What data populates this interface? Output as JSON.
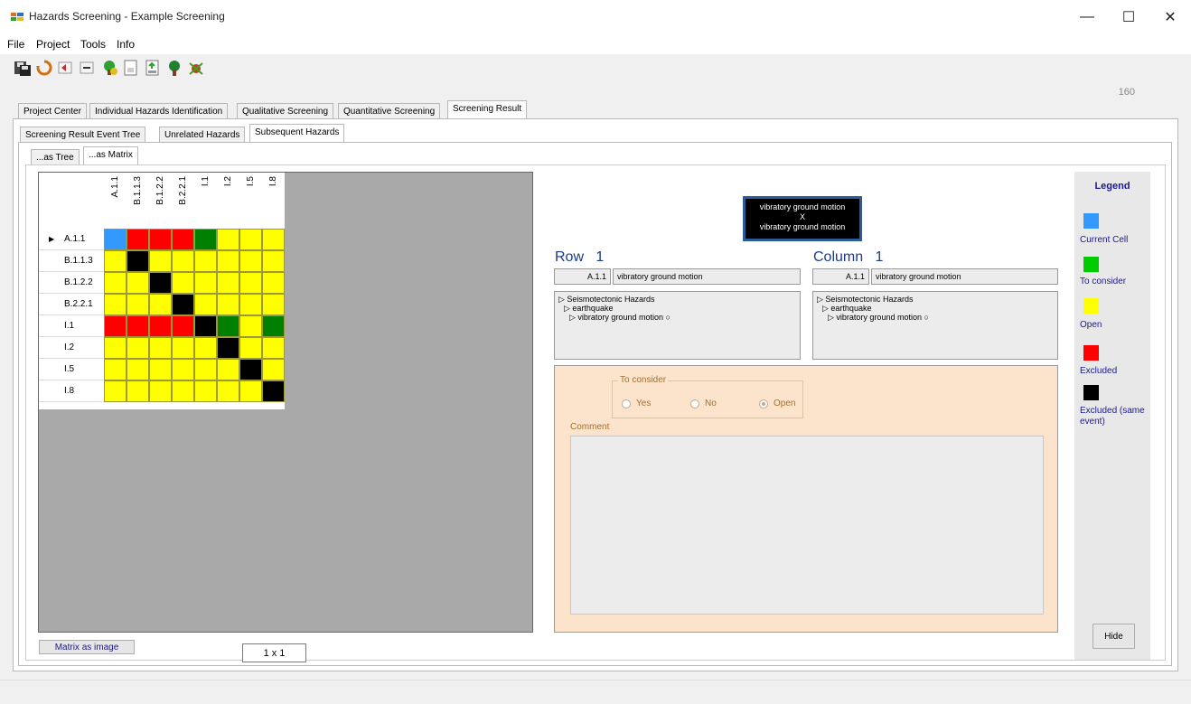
{
  "window": {
    "title": "Hazards Screening - Example Screening"
  },
  "menu": [
    "File",
    "Project",
    "Tools",
    "Info"
  ],
  "counter": "160",
  "main_tabs": [
    "Project Center",
    "Individual Hazards Identification",
    "Qualitative Screening",
    "Quantitative Screening",
    "Screening Result"
  ],
  "sub_tabs": [
    "Screening Result Event Tree",
    "Unrelated Hazards",
    "Subsequent Hazards"
  ],
  "view_tabs": [
    "...as Tree",
    "...as Matrix"
  ],
  "matrix": {
    "columns": [
      "A.1.1",
      "B.1.1.3",
      "B.1.2.2",
      "B.2.2.1",
      "I.1",
      "I.2",
      "I.5",
      "I.8"
    ],
    "rows": [
      "A.1.1",
      "B.1.1.3",
      "B.1.2.2",
      "B.2.2.1",
      "I.1",
      "I.2",
      "I.5",
      "I.8"
    ],
    "current_row_marker": "▶",
    "cells": [
      [
        "current",
        "excluded",
        "excluded",
        "excluded",
        "consider",
        "open",
        "open",
        "open"
      ],
      [
        "open",
        "same",
        "open",
        "open",
        "open",
        "open",
        "open",
        "open"
      ],
      [
        "open",
        "open",
        "same",
        "open",
        "open",
        "open",
        "open",
        "open"
      ],
      [
        "open",
        "open",
        "open",
        "same",
        "open",
        "open",
        "open",
        "open"
      ],
      [
        "excluded",
        "excluded",
        "excluded",
        "excluded",
        "same",
        "consider",
        "open",
        "consider"
      ],
      [
        "open",
        "open",
        "open",
        "open",
        "open",
        "same",
        "open",
        "open"
      ],
      [
        "open",
        "open",
        "open",
        "open",
        "open",
        "open",
        "same",
        "open"
      ],
      [
        "open",
        "open",
        "open",
        "open",
        "open",
        "open",
        "open",
        "same"
      ]
    ]
  },
  "buttons": {
    "matrix_as_image": "Matrix as image",
    "zoom": "1 x 1",
    "hide": "Hide"
  },
  "selection": {
    "line1": "vibratory ground motion",
    "line2": "X",
    "line3": "vibratory ground motion"
  },
  "row_info": {
    "label": "Row",
    "index": "1",
    "code": "A.1.1",
    "name": "vibratory ground motion",
    "tree": [
      "▷ Seismotectonic Hazards",
      "▷ earthquake",
      "▷ vibratory ground motion ○"
    ]
  },
  "col_info": {
    "label": "Column",
    "index": "1",
    "code": "A.1.1",
    "name": "vibratory ground motion",
    "tree": [
      "▷ Seismotectonic Hazards",
      "▷ earthquake",
      "▷ vibratory ground motion ○"
    ]
  },
  "consider": {
    "title": "To consider",
    "options": [
      "Yes",
      "No",
      "Open"
    ],
    "selected": "Open",
    "comment_label": "Comment",
    "comment": ""
  },
  "legend": {
    "title": "Legend",
    "items": [
      {
        "label": "Current Cell",
        "color": "#3399ff"
      },
      {
        "label": "To consider",
        "color": "#00cc00"
      },
      {
        "label": "Open",
        "color": "#ffff00"
      },
      {
        "label": "Excluded",
        "color": "#ff0000"
      },
      {
        "label": "Excluded (same event)",
        "color": "#000000"
      }
    ]
  },
  "colors": {
    "current": "#3399ff",
    "consider": "#008000",
    "open": "#ffff00",
    "excluded": "#ff0000",
    "same": "#000000"
  }
}
